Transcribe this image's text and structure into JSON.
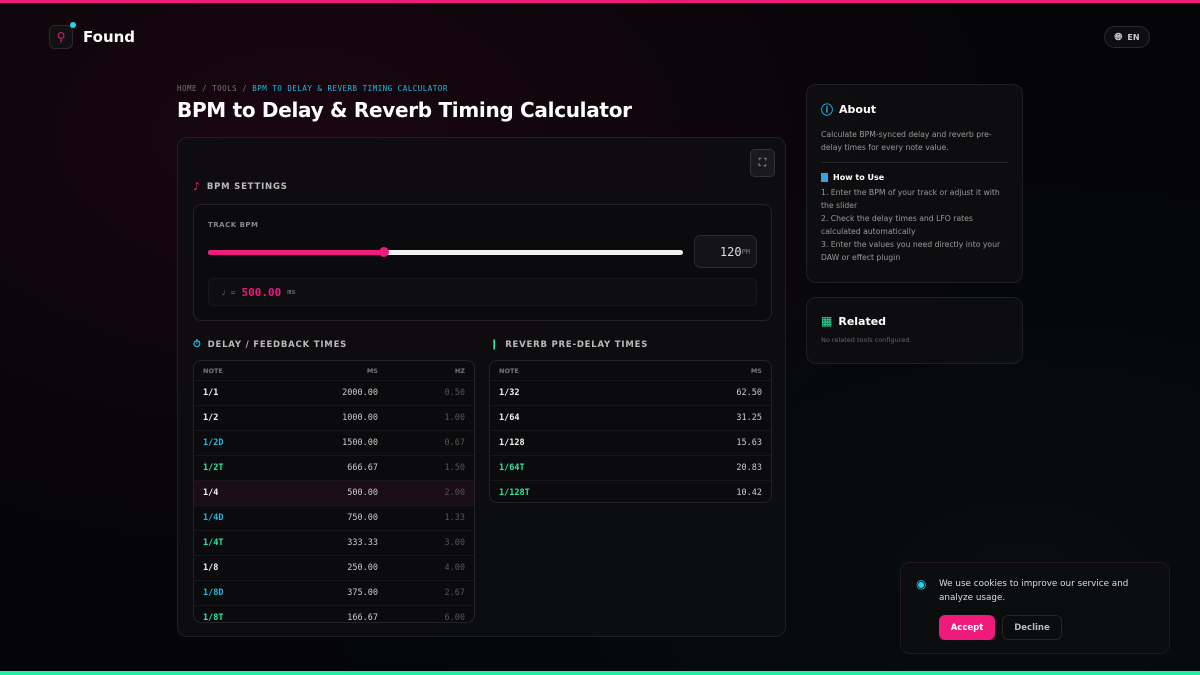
{
  "colors": {
    "accent": "#ee1a7c",
    "cyan": "#22b8e0",
    "green": "#2ee6a0"
  },
  "header": {
    "logo": "Found",
    "lang": "EN"
  },
  "breadcrumb": {
    "home": "HOME",
    "tools": "TOOLS",
    "current": "BPM TO DELAY & REVERB TIMING CALCULATOR",
    "sep": "/"
  },
  "title": "BPM to Delay & Reverb Timing Calculator",
  "bpm": {
    "section": "BPM SETTINGS",
    "label": "TRACK BPM",
    "value": "120",
    "unit": "BPM",
    "slider_fraction": 0.37,
    "quarter_symbol": "♩ =",
    "quarter_ms": "500.00",
    "ms_unit": "ms"
  },
  "delay": {
    "section": "DELAY / FEEDBACK TIMES",
    "headers": [
      "NOTE",
      "MS",
      "HZ"
    ],
    "rows": [
      {
        "note": "1/1",
        "ms": "2000.00",
        "hz": "0.50",
        "type": "normal"
      },
      {
        "note": "1/2",
        "ms": "1000.00",
        "hz": "1.00",
        "type": "normal"
      },
      {
        "note": "1/2D",
        "ms": "1500.00",
        "hz": "0.67",
        "type": "dotted"
      },
      {
        "note": "1/2T",
        "ms": "666.67",
        "hz": "1.50",
        "type": "triplet"
      },
      {
        "note": "1/4",
        "ms": "500.00",
        "hz": "2.00",
        "type": "normal",
        "highlight": true
      },
      {
        "note": "1/4D",
        "ms": "750.00",
        "hz": "1.33",
        "type": "dotted"
      },
      {
        "note": "1/4T",
        "ms": "333.33",
        "hz": "3.00",
        "type": "triplet"
      },
      {
        "note": "1/8",
        "ms": "250.00",
        "hz": "4.00",
        "type": "normal"
      },
      {
        "note": "1/8D",
        "ms": "375.00",
        "hz": "2.67",
        "type": "dotted"
      },
      {
        "note": "1/8T",
        "ms": "166.67",
        "hz": "6.00",
        "type": "triplet"
      }
    ]
  },
  "reverb": {
    "section": "REVERB PRE-DELAY TIMES",
    "headers": [
      "NOTE",
      "MS"
    ],
    "rows": [
      {
        "note": "1/32",
        "ms": "62.50",
        "type": "normal"
      },
      {
        "note": "1/64",
        "ms": "31.25",
        "type": "normal"
      },
      {
        "note": "1/128",
        "ms": "15.63",
        "type": "normal"
      },
      {
        "note": "1/64T",
        "ms": "20.83",
        "type": "triplet"
      },
      {
        "note": "1/128T",
        "ms": "10.42",
        "type": "triplet"
      }
    ]
  },
  "about": {
    "title": "About",
    "desc": "Calculate BPM-synced delay and reverb pre-delay times for every note value.",
    "howto_title": "How to Use",
    "steps": [
      "1. Enter the BPM of your track or adjust it with the slider",
      "2. Check the delay times and LFO rates calculated automatically",
      "3. Enter the values you need directly into your DAW or effect plugin"
    ]
  },
  "related": {
    "title": "Related",
    "empty": "No related tools configured."
  },
  "cookie": {
    "text": "We use cookies to improve our service and analyze usage.",
    "accept": "Accept",
    "decline": "Decline"
  }
}
